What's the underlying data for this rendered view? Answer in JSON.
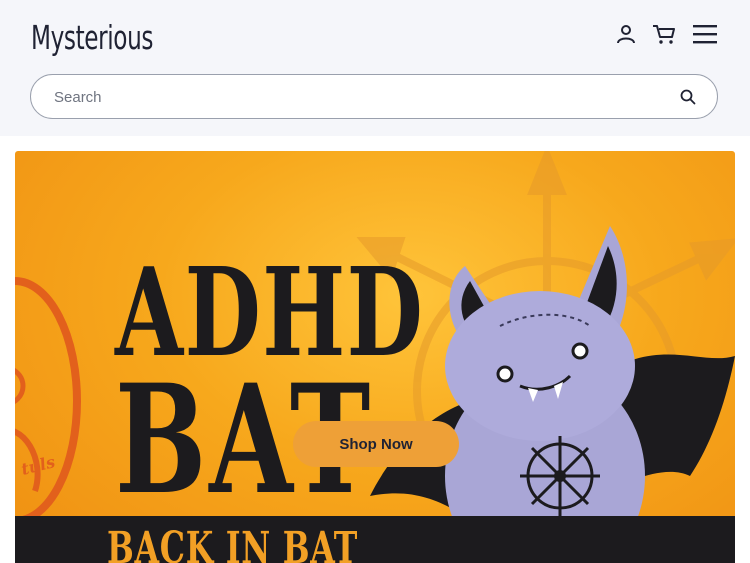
{
  "header": {
    "brand": "Mysterious",
    "icons": [
      "account-icon",
      "cart-icon",
      "menu-icon"
    ]
  },
  "search": {
    "placeholder": "Search",
    "value": ""
  },
  "banner": {
    "title_line1": "ADHD",
    "title_line2": "BAT",
    "tagline": "BACK IN BAT",
    "side_logo_text": "tuls",
    "cta_label": "Shop Now"
  },
  "colors": {
    "header_bg": "#f5f6fa",
    "banner_orange": "#f7a81c",
    "cta": "#eea037",
    "dark_band": "#1c1b1e",
    "bat_purple": "#a9a6d6"
  }
}
